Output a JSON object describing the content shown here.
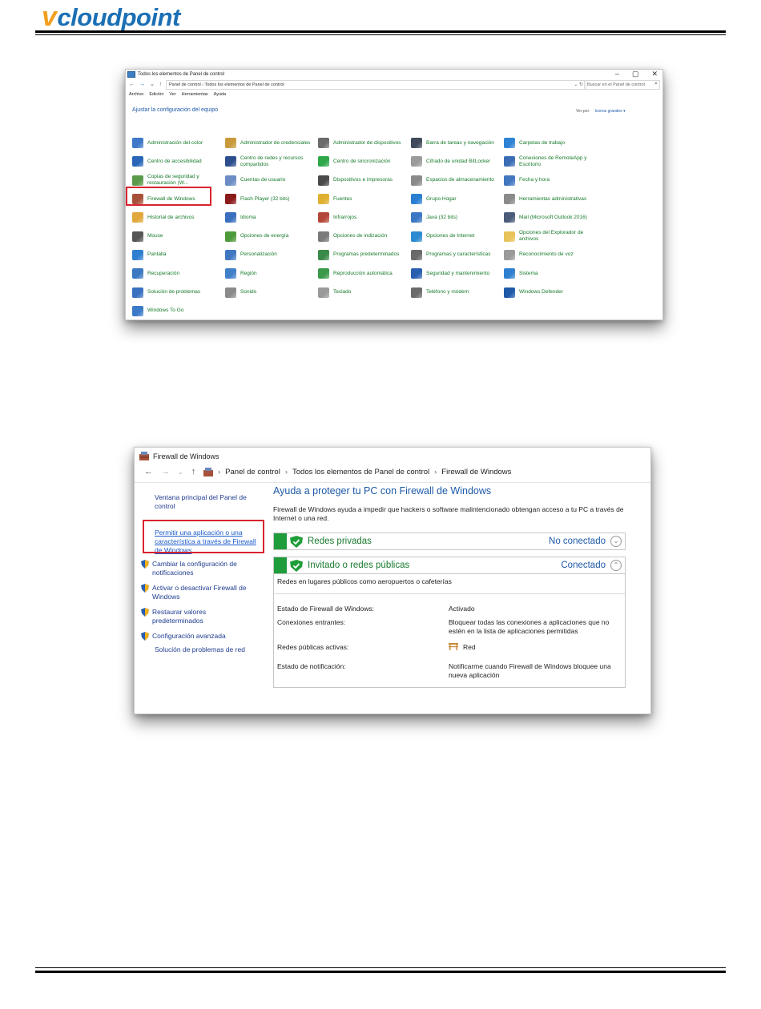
{
  "header": {
    "logo_mark": "v",
    "logo_text": "cloudpoint"
  },
  "cp": {
    "window_title": "Todos los elementos de Panel de control",
    "win_min": "–",
    "win_max": "▢",
    "win_close": "✕",
    "nav_back": "←",
    "nav_fwd": "→",
    "nav_down": "⌄",
    "nav_up": "↑",
    "breadcrumb": "Panel de control  ›  Todos los elementos de Panel de control",
    "search_placeholder": "Buscar en el Panel de control",
    "menu": [
      "Archivo",
      "Edición",
      "Ver",
      "Herramientas",
      "Ayuda"
    ],
    "adjust_title": "Ajustar la configuración del equipo",
    "view_by_label": "Ver por:",
    "view_by_value": "Iconos grandes ▾",
    "items": [
      {
        "label": "Administración del color",
        "color": "#3d79c8"
      },
      {
        "label": "Administrador de credenciales",
        "color": "#c99a3a"
      },
      {
        "label": "Administrador de dispositivos",
        "color": "#6b6b6b"
      },
      {
        "label": "Barra de tareas y navegación",
        "color": "#404a5c"
      },
      {
        "label": "Carpetas de trabajo",
        "color": "#2f83d4"
      },
      {
        "label": "Centro de accesibilidad",
        "color": "#2966b8"
      },
      {
        "label": "Centro de redes y recursos compartidos",
        "color": "#2d4e8c"
      },
      {
        "label": "Centro de sincronización",
        "color": "#2fa84a"
      },
      {
        "label": "Cifrado de unidad BitLocker",
        "color": "#9b9b9b"
      },
      {
        "label": "Conexiones de RemoteApp y Escritorio",
        "color": "#3b6db5"
      },
      {
        "label": "Copias de seguridad y restauración (W...",
        "color": "#5c9a4b"
      },
      {
        "label": "Cuentas de usuario",
        "color": "#6b8cc4"
      },
      {
        "label": "Dispositivos e impresoras",
        "color": "#4a4a4a"
      },
      {
        "label": "Espacios de almacenamiento",
        "color": "#8a8a8a"
      },
      {
        "label": "Fecha y hora",
        "color": "#4277c0"
      },
      {
        "label": "Firewall de Windows",
        "color": "#a8513a"
      },
      {
        "label": "Flash Player (32 bits)",
        "color": "#8b1a1a"
      },
      {
        "label": "Fuentes",
        "color": "#e0b030"
      },
      {
        "label": "Grupo Hogar",
        "color": "#2a7fd0"
      },
      {
        "label": "Herramientas administrativas",
        "color": "#8a8a8a"
      },
      {
        "label": "Historial de archivos",
        "color": "#e0a83a"
      },
      {
        "label": "Idioma",
        "color": "#3a6fc0"
      },
      {
        "label": "Infrarrojos",
        "color": "#b5473a"
      },
      {
        "label": "Java (32 bits)",
        "color": "#3b78c4"
      },
      {
        "label": "Mail (Microsoft Outlook 2016)",
        "color": "#4a5c7a"
      },
      {
        "label": "Mouse",
        "color": "#555555"
      },
      {
        "label": "Opciones de energía",
        "color": "#4d9a3a"
      },
      {
        "label": "Opciones de indización",
        "color": "#7a7a7a"
      },
      {
        "label": "Opciones de Internet",
        "color": "#2c8ad0"
      },
      {
        "label": "Opciones del Explorador de archivos",
        "color": "#e8c25a"
      },
      {
        "label": "Pantalla",
        "color": "#2f7fd0"
      },
      {
        "label": "Personalización",
        "color": "#3f78c0"
      },
      {
        "label": "Programas predeterminados",
        "color": "#3a8a4a"
      },
      {
        "label": "Programas y características",
        "color": "#6a6a6a"
      },
      {
        "label": "Reconocimiento de voz",
        "color": "#9a9a9a"
      },
      {
        "label": "Recuperación",
        "color": "#3a78c0"
      },
      {
        "label": "Región",
        "color": "#3f80c8"
      },
      {
        "label": "Reproducción automática",
        "color": "#3a9a4a"
      },
      {
        "label": "Seguridad y mantenimiento",
        "color": "#2a5fb0"
      },
      {
        "label": "Sistema",
        "color": "#2f80d0"
      },
      {
        "label": "Solución de problemas",
        "color": "#3a70c0"
      },
      {
        "label": "Sonido",
        "color": "#8a8a8a"
      },
      {
        "label": "Teclado",
        "color": "#9a9a9a"
      },
      {
        "label": "Teléfono y módem",
        "color": "#6a6a6a"
      },
      {
        "label": "Windows Defender",
        "color": "#1e5aa8"
      },
      {
        "label": "Windows To Go",
        "color": "#3a7ac8"
      }
    ]
  },
  "fw": {
    "window_title": "Firewall de Windows",
    "nav_back": "←",
    "nav_fwd": "→",
    "nav_down": "⌄",
    "nav_up": "↑",
    "crumbs": [
      "Panel de control",
      "Todos los elementos de Panel de control",
      "Firewall de Windows"
    ],
    "crumb_sep": "›",
    "side_main": "Ventana principal del Panel de control",
    "side_allow": "Permitir una aplicación o una característica a través de Firewall de Windows",
    "side_change_notif": "Cambiar la configuración de notificaciones",
    "side_toggle": "Activar o desactivar Firewall de Windows",
    "side_restore": "Restaurar valores predeterminados",
    "side_advanced": "Configuración avanzada",
    "side_troubleshoot": "Solución de problemas de red",
    "main_title": "Ayuda a proteger tu PC con Firewall de Windows",
    "main_desc": "Firewall de Windows ayuda a impedir que hackers o software malintencionado obtengan acceso a tu PC a través de Internet o una red.",
    "private_name": "Redes privadas",
    "private_status": "No conectado",
    "private_chev": "⌄",
    "public_name": "Invitado o redes públicas",
    "public_status": "Conectado",
    "public_chev": "⌃",
    "public_intro": "Redes en lugares públicos como aeropuertos o cafeterías",
    "rows": [
      {
        "k": "Estado de Firewall de Windows:",
        "v": "Activado"
      },
      {
        "k": "Conexiones entrantes:",
        "v": "Bloquear todas las conexiones a aplicaciones que no estén en la lista de aplicaciones permitidas"
      },
      {
        "k": "Redes públicas activas:",
        "v": "Red"
      },
      {
        "k": "Estado de notificación:",
        "v": "Notificarme cuando Firewall de Windows bloquee una nueva aplicación"
      }
    ],
    "accent_green": "#1f9d3a",
    "accent_blue": "#1e5aa8",
    "highlight_red": "#d9232e"
  }
}
